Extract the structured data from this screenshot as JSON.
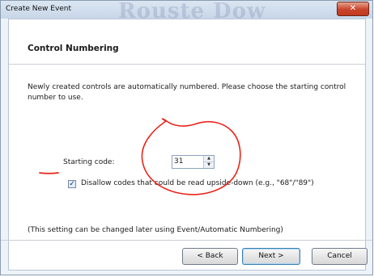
{
  "window": {
    "title": "Create New Event",
    "close_glyph": "✕",
    "background_title_fragment": "Rouste Dow"
  },
  "header": {
    "title": "Control Numbering"
  },
  "main": {
    "description": "Newly created controls are automatically numbered. Please choose the starting control number to use.",
    "starting_code_label": "Starting code:",
    "starting_code_value": "31",
    "disallow_checkbox_checked": true,
    "disallow_checkbox_glyph": "✓",
    "disallow_label": "Disallow codes that could be read upside-down (e.g., \"68\"/\"89\")",
    "note": "(This setting can be changed later using Event/Automatic Numbering)"
  },
  "footer": {
    "back_label": "< Back",
    "next_label": "Next >",
    "cancel_label": "Cancel"
  },
  "annotation_color": "#e8251b",
  "icons": [
    "close-icon",
    "spin-up-icon",
    "spin-down-icon",
    "checkmark-icon"
  ]
}
